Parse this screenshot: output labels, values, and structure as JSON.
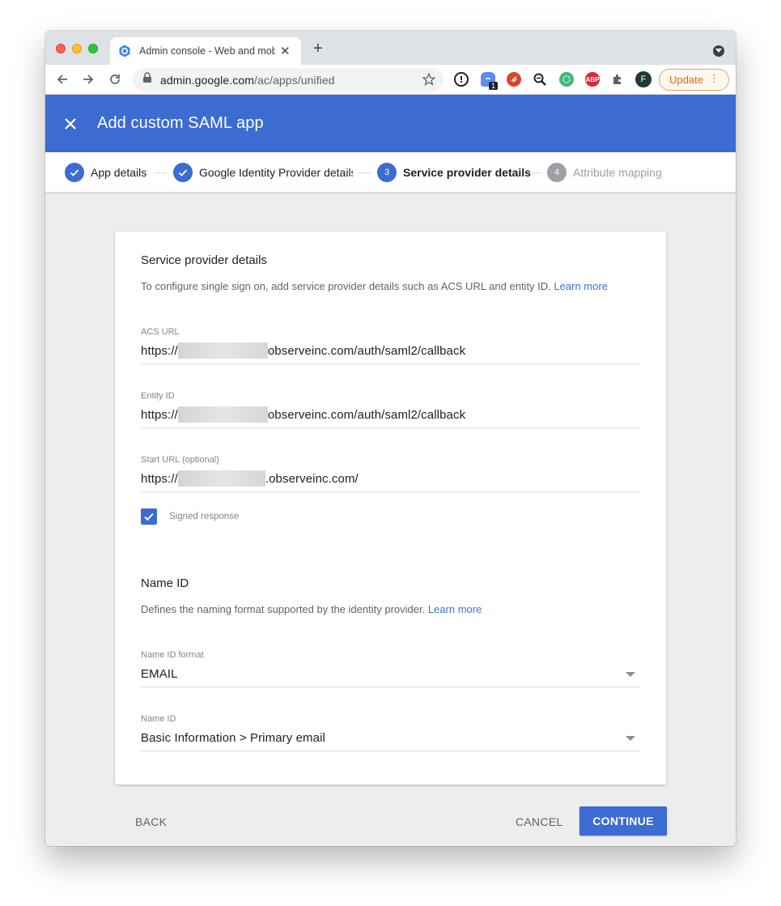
{
  "browser": {
    "tab_title": "Admin console - Web and mob",
    "url_domain": "admin.google.com",
    "url_path": "/ac/apps/unified",
    "profile_initial": "F",
    "update_label": "Update",
    "ext_badge": "1",
    "ext_abp": "ABP"
  },
  "header": {
    "title": "Add custom SAML app"
  },
  "stepper": {
    "steps": [
      {
        "number": "",
        "label": "App details",
        "state": "done"
      },
      {
        "number": "",
        "label": "Google Identity Provider details",
        "state": "done"
      },
      {
        "number": "3",
        "label": "Service provider details",
        "state": "active"
      },
      {
        "number": "4",
        "label": "Attribute mapping",
        "state": "pending"
      }
    ]
  },
  "card": {
    "sp_section": {
      "title": "Service provider details",
      "description": "To configure single sign on, add service provider details such as ACS URL and entity ID.",
      "learn_more": "Learn more"
    },
    "acs_url": {
      "label": "ACS URL",
      "prefix": "https://",
      "suffix": "observeinc.com/auth/saml2/callback"
    },
    "entity_id": {
      "label": "Entity ID",
      "prefix": "https://",
      "suffix": "observeinc.com/auth/saml2/callback"
    },
    "start_url": {
      "label": "Start URL (optional)",
      "prefix": "https://",
      "suffix": ".observeinc.com/"
    },
    "signed_response": {
      "label": "Signed response",
      "checked": true
    },
    "name_id_section": {
      "title": "Name ID",
      "description": "Defines the naming format supported by the identity provider.",
      "learn_more": "Learn more"
    },
    "name_id_format": {
      "label": "Name ID format",
      "value": "EMAIL"
    },
    "name_id": {
      "label": "Name ID",
      "value": "Basic Information > Primary email"
    }
  },
  "footer": {
    "back": "BACK",
    "cancel": "CANCEL",
    "continue": "CONTINUE"
  },
  "colors": {
    "primary": "#3c6bd2",
    "pending_step": "#9aa0a6"
  }
}
